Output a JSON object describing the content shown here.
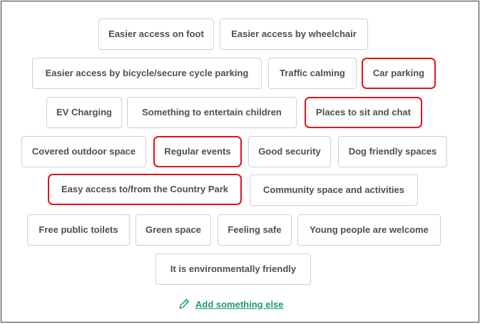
{
  "options": [
    {
      "label": "Easier access on foot",
      "selected": false
    },
    {
      "label": "Easier access by wheelchair",
      "selected": false
    },
    {
      "label": "Easier access by bicycle/secure cycle parking",
      "selected": false
    },
    {
      "label": "Traffic calming",
      "selected": false
    },
    {
      "label": "Car parking",
      "selected": true
    },
    {
      "label": "EV Charging",
      "selected": false
    },
    {
      "label": "Something to entertain children",
      "selected": false
    },
    {
      "label": "Places to sit and chat",
      "selected": true
    },
    {
      "label": "Covered outdoor space",
      "selected": false
    },
    {
      "label": "Regular events",
      "selected": true
    },
    {
      "label": "Good security",
      "selected": false
    },
    {
      "label": "Dog friendly spaces",
      "selected": false
    },
    {
      "label": "Easy access to/from the Country Park",
      "selected": true
    },
    {
      "label": "Community space and activities",
      "selected": false
    },
    {
      "label": "Free public toilets",
      "selected": false
    },
    {
      "label": "Green space",
      "selected": false
    },
    {
      "label": "Feeling safe",
      "selected": false
    },
    {
      "label": "Young people are welcome",
      "selected": false
    },
    {
      "label": "It is environmentally friendly",
      "selected": false
    }
  ],
  "add_link": {
    "label": "Add something else",
    "icon": "pencil-icon"
  },
  "colors": {
    "selected_border": "#e3141b",
    "chip_border": "#cfcfcf",
    "chip_text": "#4f4f4f",
    "link": "#1d9a6c"
  }
}
